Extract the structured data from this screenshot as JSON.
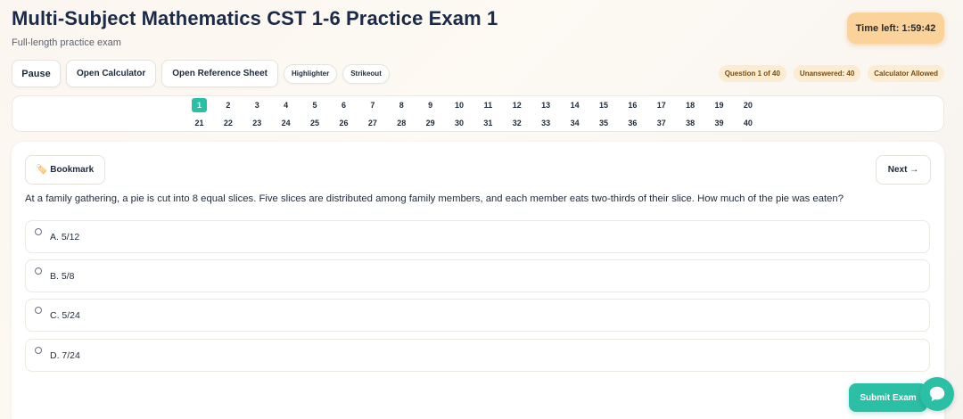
{
  "header": {
    "title": "Multi-Subject Mathematics CST 1-6 Practice Exam 1",
    "subtitle": "Full-length practice exam",
    "timer": "Time left: 1:59:42"
  },
  "toolbar": {
    "pause": "Pause",
    "calculator": "Open Calculator",
    "reference": "Open Reference Sheet",
    "highlighter": "Highlighter",
    "strikeout": "Strikeout"
  },
  "badges": {
    "question": "Question 1 of 40",
    "unanswered": "Unanswered: 40",
    "calculator": "Calculator Allowed"
  },
  "navigator": {
    "questions": [
      "1",
      "2",
      "3",
      "4",
      "5",
      "6",
      "7",
      "8",
      "9",
      "10",
      "11",
      "12",
      "13",
      "14",
      "15",
      "16",
      "17",
      "18",
      "19",
      "20",
      "21",
      "22",
      "23",
      "24",
      "25",
      "26",
      "27",
      "28",
      "29",
      "30",
      "31",
      "32",
      "33",
      "34",
      "35",
      "36",
      "37",
      "38",
      "39",
      "40"
    ],
    "active": "1"
  },
  "card": {
    "bookmark_icon": "🏷️",
    "bookmark": "Bookmark",
    "next": "Next →",
    "question": "At a family gathering, a pie is cut into 8 equal slices. Five slices are distributed among family members, and each member eats two-thirds of their slice. How much of the pie was eaten?",
    "options": [
      "A. 5/12",
      "B. 5/8",
      "C. 5/24",
      "D. 7/24"
    ]
  },
  "submit": "Submit Exam",
  "colors": {
    "accent": "#2bbfa5",
    "timer_bg": "#fbd39a",
    "badge_bg": "#fbecd2"
  }
}
